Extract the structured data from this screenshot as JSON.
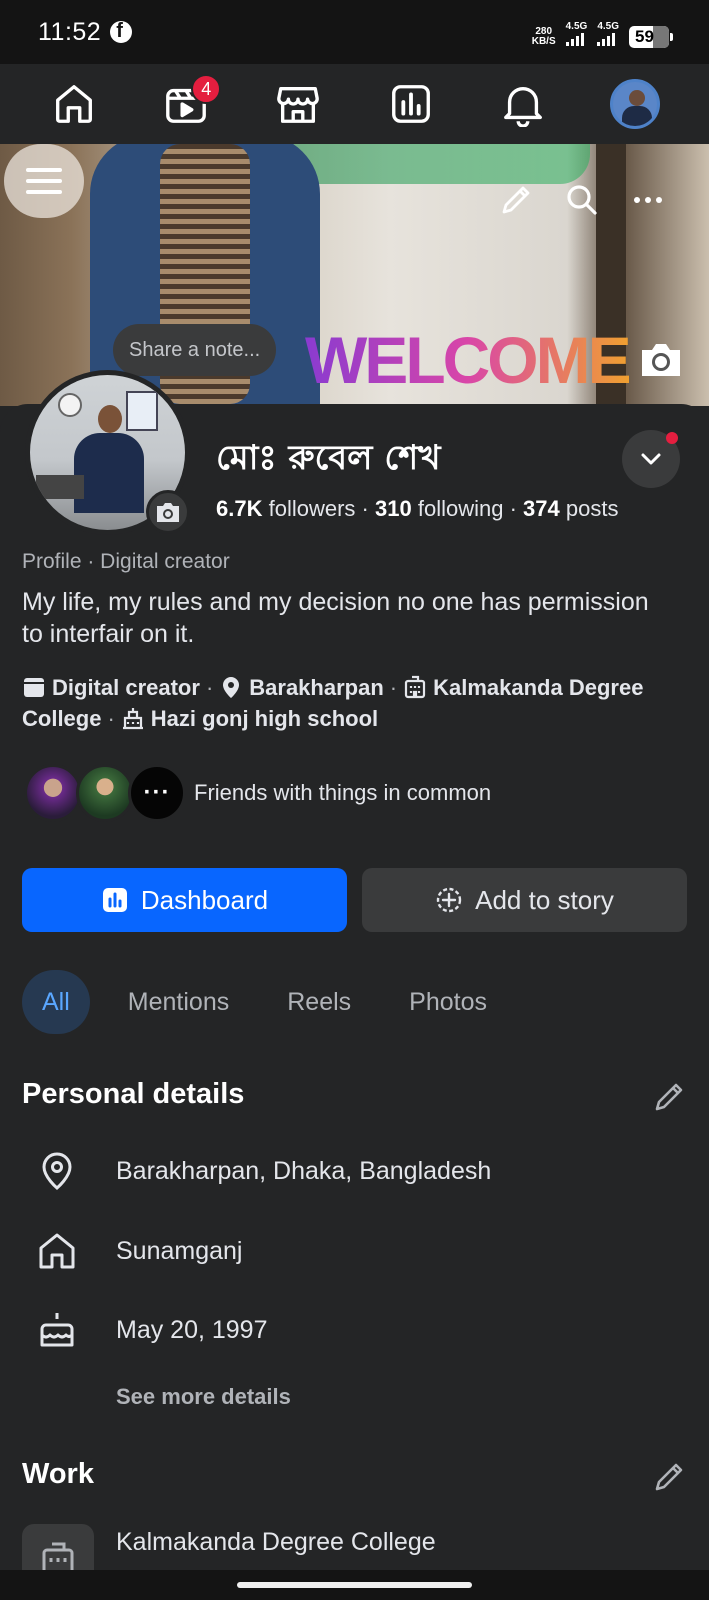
{
  "status_bar": {
    "time": "11:52",
    "speed_value": "280",
    "speed_unit": "KB/S",
    "net1": "4.5G",
    "net2": "4.5G",
    "battery": "59"
  },
  "nav": {
    "items": [
      {
        "name": "home",
        "icon": "home-icon"
      },
      {
        "name": "video",
        "icon": "video-icon",
        "badge": "4"
      },
      {
        "name": "marketplace",
        "icon": "store-icon"
      },
      {
        "name": "dashboard",
        "icon": "chart-icon"
      },
      {
        "name": "notifications",
        "icon": "bell-icon"
      },
      {
        "name": "profile",
        "icon": "avatar",
        "active": true
      }
    ]
  },
  "cover": {
    "note_placeholder": "Share a note..."
  },
  "profile": {
    "name": "মোঃ রুবেল শেখ",
    "followers": "6.7K",
    "followers_label": "followers",
    "following": "310",
    "following_label": "following",
    "posts": "374",
    "posts_label": "posts",
    "subtitle": "Profile · Digital creator",
    "bio": "My life, my rules and my decision no one has permission to interfair on it.",
    "intro": {
      "category": "Digital creator",
      "location": "Barakharpan",
      "college": "Kalmakanda Degree College",
      "school": "Hazi gonj high school"
    },
    "friends_text": "Friends with things in common",
    "friends_more": "···"
  },
  "actions": {
    "dashboard_label": "Dashboard",
    "add_story_label": "Add to story"
  },
  "tabs": [
    "All",
    "Mentions",
    "Reels",
    "Photos"
  ],
  "personal_details": {
    "title": "Personal details",
    "location": "Barakharpan, Dhaka, Bangladesh",
    "hometown": "Sunamganj",
    "birthday": "May 20, 1997",
    "see_more": "See more details"
  },
  "work": {
    "title": "Work",
    "place": "Kalmakanda Degree College"
  },
  "colors": {
    "background": "#242526",
    "primary": "#0866ff",
    "badge": "#e41e3f",
    "active_tab_bg": "#263951",
    "active_tab_text": "#5aa7ff"
  }
}
